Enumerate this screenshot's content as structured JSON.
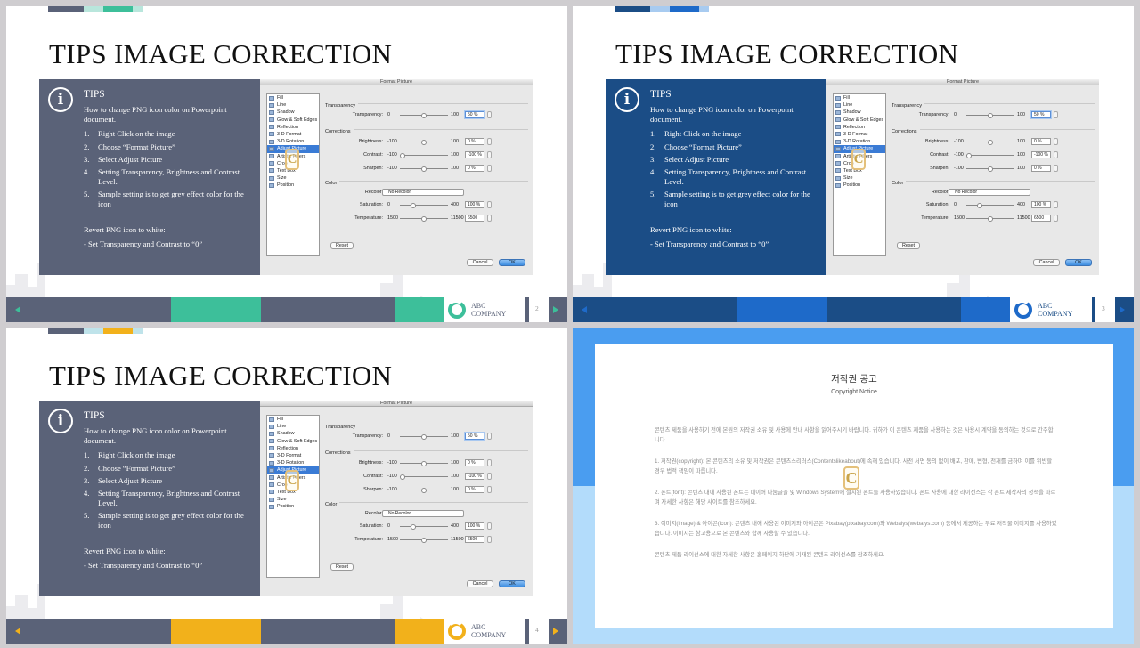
{
  "slides": [
    {
      "number": "2",
      "panel_color": "#5a6278",
      "accent": "#3dbf9a",
      "accent2": "#b9e6dc"
    },
    {
      "number": "3",
      "panel_color": "#1b4d86",
      "accent": "#1e6ac9",
      "accent2": "#a8cbf0"
    },
    {
      "number": "4",
      "panel_color": "#5a6278",
      "accent": "#f2b11b",
      "accent2": "#bfe3ea"
    }
  ],
  "title": "TIPS IMAGE CORRECTION",
  "tips": {
    "heading": "TIPS",
    "intro": "How to change PNG icon color on Powerpoint document.",
    "steps": [
      {
        "n": "1.",
        "t": "Right Click on the image"
      },
      {
        "n": "2.",
        "t": "Choose “Format Picture”"
      },
      {
        "n": "3.",
        "t": "Select Adjust Picture"
      },
      {
        "n": "4.",
        "t": "Setting Transparency, Brightness and Contrast Level."
      },
      {
        "n": "5.",
        "t": "Sample setting is to get grey effect color for the icon"
      }
    ],
    "revert": "Revert PNG icon to white:",
    "revert_step": "- Set Transparency and Contrast to “0”"
  },
  "dialog": {
    "title": "Format Picture",
    "sidebar": [
      "Fill",
      "Line",
      "Shadow",
      "Glow & Soft Edges",
      "Reflection",
      "3-D Format",
      "3-D Rotation",
      "Adjust Picture",
      "Artistic Filters",
      "Crop",
      "Text Box",
      "Size",
      "Position"
    ],
    "selected": "Adjust Picture",
    "group_transparency": "Transparency",
    "group_corrections": "Corrections",
    "group_color": "Color",
    "transparency": {
      "label": "Transparency:",
      "min": "0",
      "max": "100",
      "value": "50 %",
      "pos": 0.5
    },
    "brightness": {
      "label": "Brightness:",
      "min": "-100",
      "max": "100",
      "value": "0 %",
      "pos": 0.5
    },
    "contrast": {
      "label": "Contrast:",
      "min": "-100",
      "max": "100",
      "value": "-100 %",
      "pos": 0.0
    },
    "sharpen": {
      "label": "Sharpen:",
      "min": "-100",
      "max": "100",
      "value": "0 %",
      "pos": 0.5
    },
    "recolor": {
      "label": "Recolor:",
      "value": "No Recolor"
    },
    "saturation": {
      "label": "Saturation:",
      "min": "0",
      "max": "400",
      "value": "100 %",
      "pos": 0.25
    },
    "temperature": {
      "label": "Temperature:",
      "min": "1500",
      "max": "11500",
      "value": "6500",
      "pos": 0.5
    },
    "reset": "Reset",
    "cancel": "Cancel",
    "ok": "OK"
  },
  "company": {
    "line1": "ABC",
    "line2": "COMPANY"
  },
  "copyright": {
    "title": "저작권 공고",
    "subtitle": "Copyright Notice",
    "paragraphs": [
      "콘텐츠 제품을 사용하기 전에 본원의 저작권 소유 및 사용에 안내 사항을 읽어주시기 바랍니다. 귀하가 이 콘텐츠 제품을 사용하는 것은 사용시 계약을 동의하는 것으로 간주합니다.",
      "1. 저작권(copyright): 본 콘텐츠의 소유 및 저작권은 콘텐츠스리러스(Contentslikeabout)에 속해 있습니다. 사전 서면 동의 없이 배포, 판매, 변형, 전재를 금하며 이를 위반할 경우 법적 책임이 따릅니다.",
      "2. 폰트(font): 콘텐츠 내에 사용된 폰트는 네이버 나눔글꼴 및 Windows System에 설치된 폰트를 사용하였습니다. 폰트 사용에 대한 라이선스는 각 폰트 제작사의 정책을 따르며 자세한 사항은 해당 사이트를 참조하세요.",
      "3. 이미지(image) & 아이콘(icon): 콘텐츠 내에 사용된 이미지와 아이콘은 Pixabay(pixabay.com)와 Webalys(webalys.com) 등에서 제공하는 무료 저작물 이미지를 사용하였습니다. 이미지는 참고용으로 본 콘텐츠와 함께 사용할 수 있습니다.",
      "콘텐츠 제품 라이선스에 대한 자세한 사항은 홈페이지 하단에 기재된 콘텐츠 라이선스를 참조하세요."
    ]
  }
}
